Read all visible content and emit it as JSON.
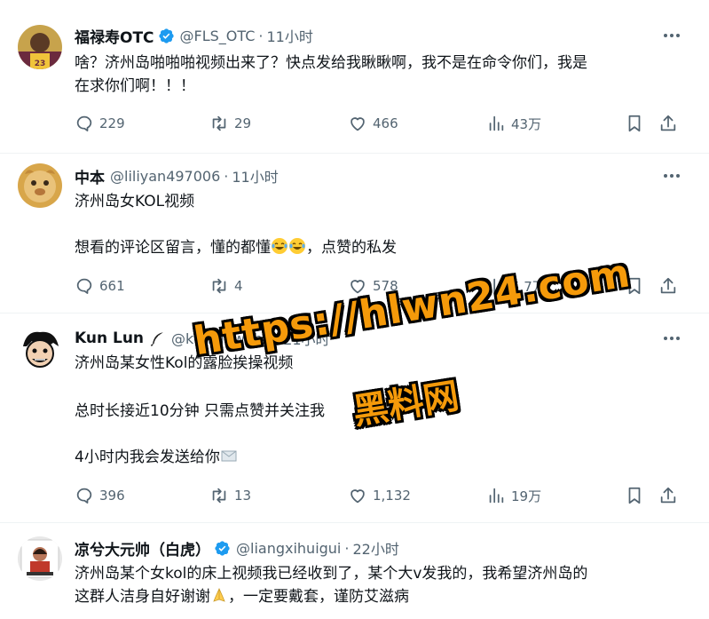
{
  "tweets": [
    {
      "name": "福禄寿OTC",
      "verified": true,
      "handle": "@FLS_OTC",
      "dot": "·",
      "time": "11小时",
      "lines": [
        "啥？济州岛啪啪啪视频出来了？快点发给我瞅瞅啊，我不是在命令你们，我是",
        "在求你们啊！！！"
      ],
      "replies": "229",
      "retweets": "29",
      "likes": "466",
      "views": "43万"
    },
    {
      "name": "中本",
      "verified": false,
      "handle": "@liliyan497006",
      "dot": "·",
      "time": "11小时",
      "lines": [
        "济州岛女KOL视频",
        "",
        "想看的评论区留言，懂的都懂",
        "，点赞的私发"
      ],
      "emojis": [
        "face-with-tears-of-joy",
        "face-with-tears-of-joy"
      ],
      "replies": "661",
      "retweets": "4",
      "likes": "578",
      "views": "5.7万"
    },
    {
      "name": "Kun Lun",
      "verified": false,
      "handle": "@kunlunweb3",
      "dot": "·",
      "time": "21小时",
      "lines": [
        "济州岛某女性Kol的露脸挨操视频",
        "",
        "总时长接近10分钟 只需点赞并关注我",
        "",
        "4小时内我会发送给你"
      ],
      "replies": "396",
      "retweets": "13",
      "likes": "1,132",
      "views": "19万"
    },
    {
      "name": "凉兮大元帅（白虎）",
      "verified": true,
      "handle": "@liangxihuigui",
      "dot": "·",
      "time": "22小时",
      "lines": [
        "济州岛某个女kol的床上视频我已经收到了，某个大v发我的，我希望济州岛的",
        "这群人洁身自好谢谢",
        "，一定要戴套，谨防艾滋病"
      ]
    }
  ],
  "watermark": {
    "url": "https://hlwn24.com",
    "site": "黑料网"
  },
  "colors": {
    "text": "#0f1419",
    "secondary": "#536471",
    "verified": "#1d9bf0",
    "divider": "#eff3f4",
    "watermark": "#f59a0a"
  }
}
